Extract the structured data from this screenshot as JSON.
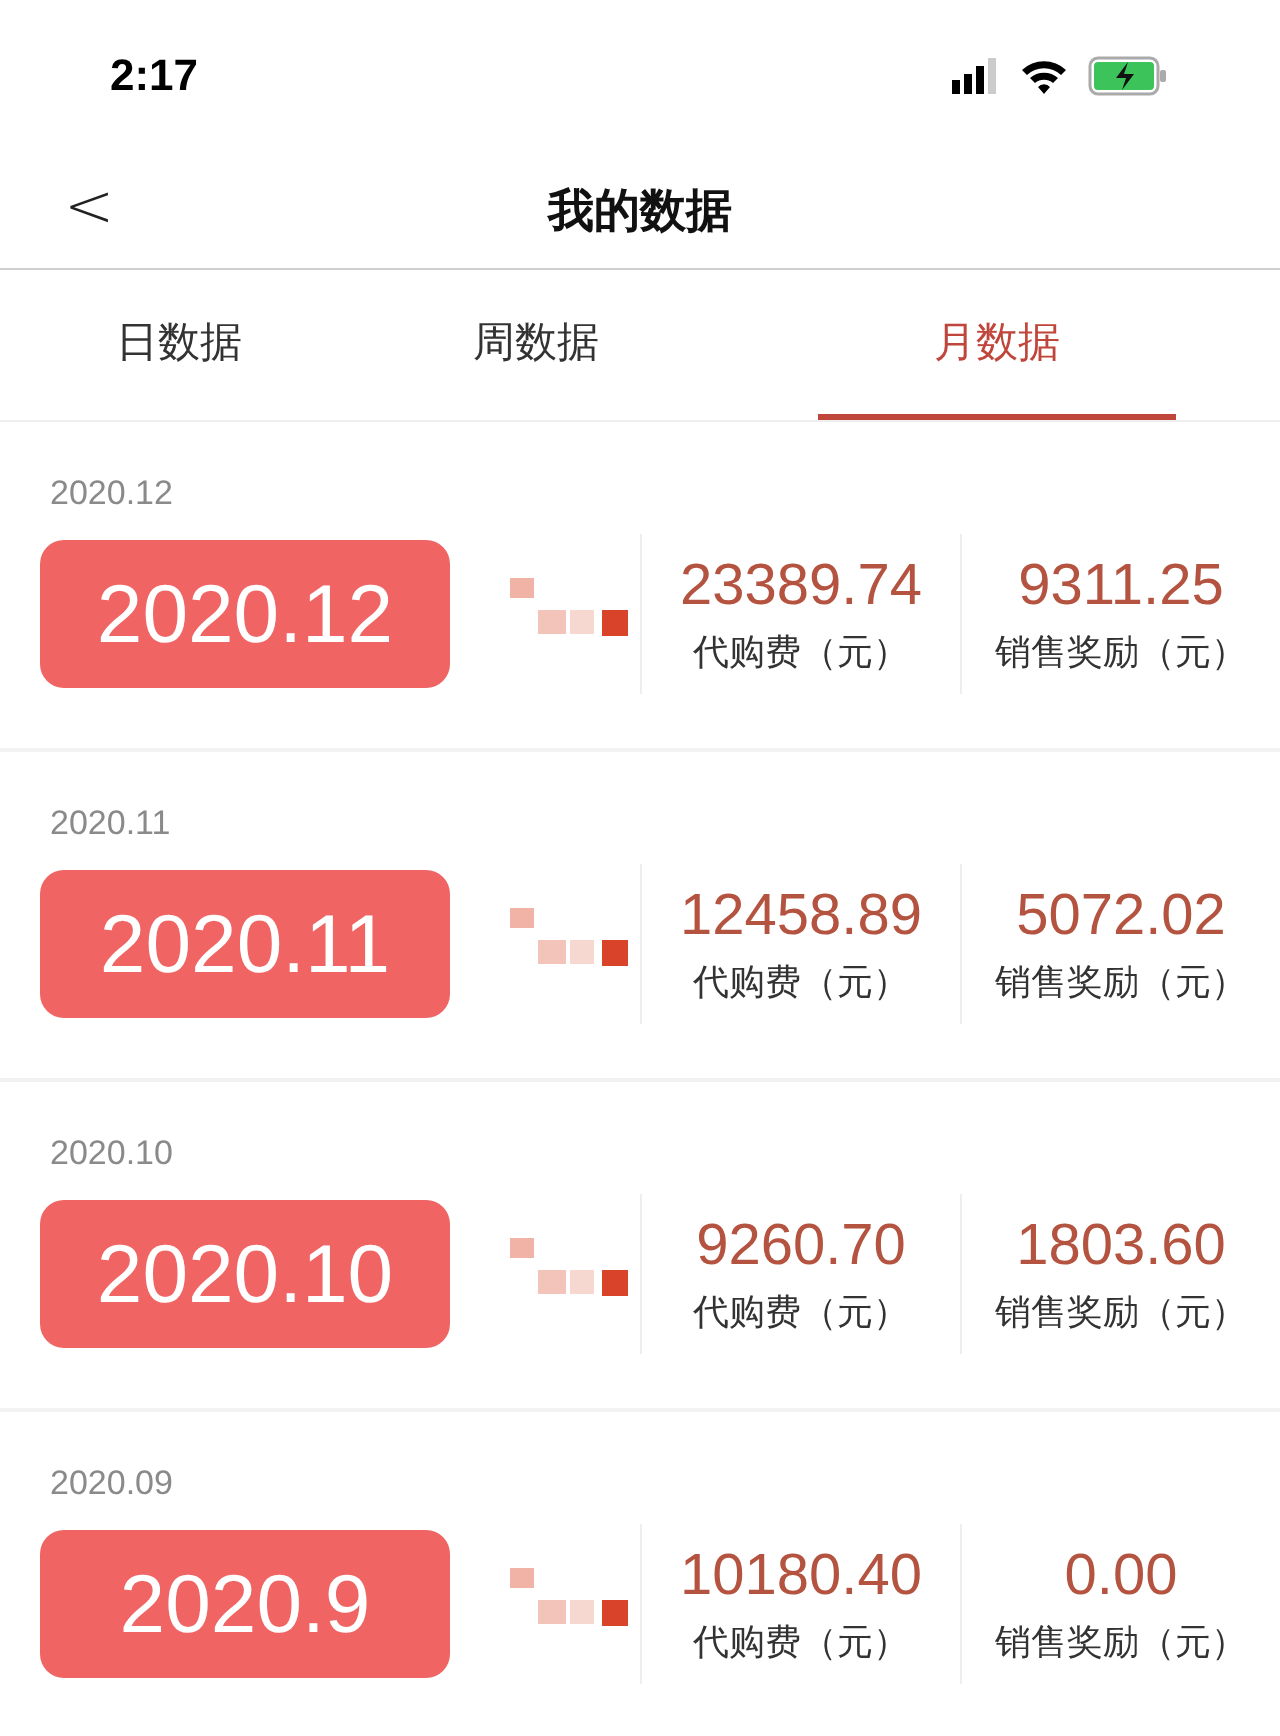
{
  "status_bar": {
    "time": "2:17"
  },
  "header": {
    "back": "<",
    "title": "我的数据"
  },
  "tabs": [
    {
      "label": "日数据",
      "selected": false
    },
    {
      "label": "周数据",
      "selected": false
    },
    {
      "label": "月数据",
      "selected": true
    }
  ],
  "rows": [
    {
      "date": "2020.12",
      "badge": "2020.12",
      "fee": "23389.74",
      "fee_label": "代购费（元）",
      "reward": "9311.25",
      "reward_label": "销售奖励（元）"
    },
    {
      "date": "2020.11",
      "badge": "2020.11",
      "fee": "12458.89",
      "fee_label": "代购费（元）",
      "reward": "5072.02",
      "reward_label": "销售奖励（元）"
    },
    {
      "date": "2020.10",
      "badge": "2020.10",
      "fee": "9260.70",
      "fee_label": "代购费（元）",
      "reward": "1803.60",
      "reward_label": "销售奖励（元）"
    },
    {
      "date": "2020.09",
      "badge": "2020.9",
      "fee": "10180.40",
      "fee_label": "代购费（元）",
      "reward": "0.00",
      "reward_label": "销售奖励（元）"
    }
  ]
}
